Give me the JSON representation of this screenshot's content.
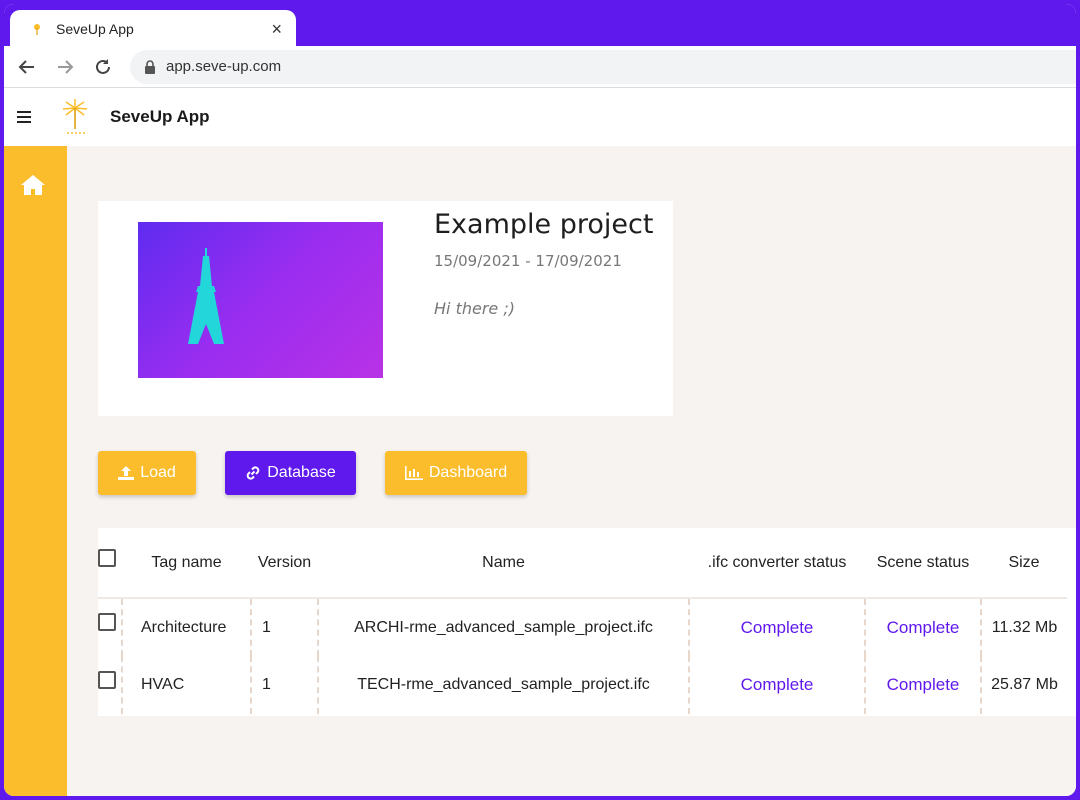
{
  "browser": {
    "tab_title": "SeveUp App",
    "tab_close": "×",
    "url": "app.seve-up.com",
    "icons": [
      "back-arrow-icon",
      "forward-arrow-icon",
      "reload-icon",
      "lock-icon"
    ]
  },
  "app": {
    "title": "SeveUp App",
    "menu_icon": "≡",
    "brand_color": "#6019ec",
    "accent_color": "#fbbd2c"
  },
  "project": {
    "title": "Example project",
    "dates": "15/09/2021 - 17/09/2021",
    "description": "Hi there ;)",
    "thumbnail_icon": "eiffel-tower-icon"
  },
  "actions": {
    "load": "Load",
    "database": "Database",
    "dashboard": "Dashboard"
  },
  "table": {
    "headers": {
      "tag": "Tag name",
      "version": "Version",
      "name": "Name",
      "ifc_status": ".ifc converter status",
      "scene_status": "Scene status",
      "size": "Size"
    },
    "rows": [
      {
        "tag": "Architecture",
        "version": "1",
        "name": "ARCHI-rme_advanced_sample_project.ifc",
        "ifc_status": "Complete",
        "scene_status": "Complete",
        "size": "11.32 Mb"
      },
      {
        "tag": "HVAC",
        "version": "1",
        "name": "TECH-rme_advanced_sample_project.ifc",
        "ifc_status": "Complete",
        "scene_status": "Complete",
        "size": "25.87 Mb"
      }
    ]
  }
}
